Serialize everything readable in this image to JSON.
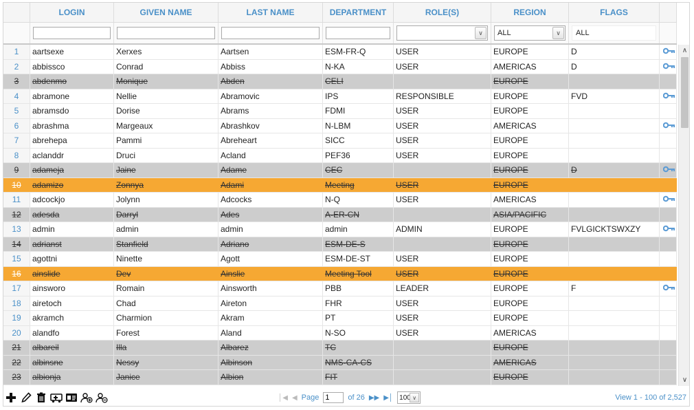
{
  "columns": [
    "LOGIN",
    "GIVEN NAME",
    "LAST NAME",
    "DEPARTMENT",
    "ROLE(S)",
    "REGION",
    "FLAGS"
  ],
  "filters": {
    "login": "",
    "given_name": "",
    "last_name": "",
    "department": "",
    "roles": "",
    "region": "ALL",
    "flags": "ALL"
  },
  "rows": [
    {
      "n": "1",
      "login": "aartsexe",
      "given": "Xerxes",
      "last": "Aartsen",
      "dept": "ESM-FR-Q",
      "role": "USER",
      "region": "EUROPE",
      "flags": "D",
      "state": "normal",
      "key": true
    },
    {
      "n": "2",
      "login": "abbissco",
      "given": "Conrad",
      "last": "Abbiss",
      "dept": "N-KA",
      "role": "USER",
      "region": "AMERICAS",
      "flags": "D",
      "state": "normal",
      "key": true
    },
    {
      "n": "3",
      "login": "abdenmo",
      "given": "Monique",
      "last": "Abden",
      "dept": "CELI",
      "role": "",
      "region": "EUROPE",
      "flags": "",
      "state": "disabled",
      "key": false
    },
    {
      "n": "4",
      "login": "abramone",
      "given": "Nellie",
      "last": "Abramovic",
      "dept": "IPS",
      "role": "RESPONSIBLE",
      "region": "EUROPE",
      "flags": "FVD",
      "state": "normal",
      "key": true
    },
    {
      "n": "5",
      "login": "abramsdo",
      "given": "Dorise",
      "last": "Abrams",
      "dept": "FDMI",
      "role": "USER",
      "region": "EUROPE",
      "flags": "",
      "state": "normal",
      "key": false
    },
    {
      "n": "6",
      "login": "abrashma",
      "given": "Margeaux",
      "last": "Abrashkov",
      "dept": "N-LBM",
      "role": "USER",
      "region": "AMERICAS",
      "flags": "",
      "state": "normal",
      "key": true
    },
    {
      "n": "7",
      "login": "abrehepa",
      "given": "Pammi",
      "last": "Abreheart",
      "dept": "SICC",
      "role": "USER",
      "region": "EUROPE",
      "flags": "",
      "state": "normal",
      "key": false
    },
    {
      "n": "8",
      "login": "aclanddr",
      "given": "Druci",
      "last": "Acland",
      "dept": "PEF36",
      "role": "USER",
      "region": "EUROPE",
      "flags": "",
      "state": "normal",
      "key": false
    },
    {
      "n": "9",
      "login": "adameja",
      "given": "Jaine",
      "last": "Adame",
      "dept": "CEC",
      "role": "",
      "region": "EUROPE",
      "flags": "D",
      "state": "disabled",
      "key": true
    },
    {
      "n": "10",
      "login": "adamizo",
      "given": "Zonnya",
      "last": "Adami",
      "dept": "Meeting",
      "role": "USER",
      "region": "EUROPE",
      "flags": "",
      "state": "orange",
      "key": false
    },
    {
      "n": "11",
      "login": "adcockjo",
      "given": "Jolynn",
      "last": "Adcocks",
      "dept": "N-Q",
      "role": "USER",
      "region": "AMERICAS",
      "flags": "",
      "state": "normal",
      "key": true
    },
    {
      "n": "12",
      "login": "adesda",
      "given": "Darryl",
      "last": "Ades",
      "dept": "A-ER-CN",
      "role": "",
      "region": "ASIA/PACIFIC",
      "flags": "",
      "state": "disabled",
      "key": false
    },
    {
      "n": "13",
      "login": "admin",
      "given": "admin",
      "last": "admin",
      "dept": "admin",
      "role": "ADMIN",
      "region": "EUROPE",
      "flags": "FVLGICKTSWXZY",
      "state": "normal",
      "key": true
    },
    {
      "n": "14",
      "login": "adrianst",
      "given": "Stanfield",
      "last": "Adriano",
      "dept": "ESM-DE-S",
      "role": "",
      "region": "EUROPE",
      "flags": "",
      "state": "disabled",
      "key": false
    },
    {
      "n": "15",
      "login": "agottni",
      "given": "Ninette",
      "last": "Agott",
      "dept": "ESM-DE-ST",
      "role": "USER",
      "region": "EUROPE",
      "flags": "",
      "state": "normal",
      "key": false
    },
    {
      "n": "16",
      "login": "ainslide",
      "given": "Dev",
      "last": "Ainslie",
      "dept": "Meeting Tool",
      "role": "USER",
      "region": "EUROPE",
      "flags": "",
      "state": "orange",
      "key": false
    },
    {
      "n": "17",
      "login": "ainsworo",
      "given": "Romain",
      "last": "Ainsworth",
      "dept": "PBB",
      "role": "LEADER",
      "region": "EUROPE",
      "flags": "F",
      "state": "normal",
      "key": true
    },
    {
      "n": "18",
      "login": "airetoch",
      "given": "Chad",
      "last": "Aireton",
      "dept": "FHR",
      "role": "USER",
      "region": "EUROPE",
      "flags": "",
      "state": "normal",
      "key": false
    },
    {
      "n": "19",
      "login": "akramch",
      "given": "Charmion",
      "last": "Akram",
      "dept": "PT",
      "role": "USER",
      "region": "EUROPE",
      "flags": "",
      "state": "normal",
      "key": false
    },
    {
      "n": "20",
      "login": "alandfo",
      "given": "Forest",
      "last": "Aland",
      "dept": "N-SO",
      "role": "USER",
      "region": "AMERICAS",
      "flags": "",
      "state": "normal",
      "key": false
    },
    {
      "n": "21",
      "login": "albareil",
      "given": "Illa",
      "last": "Albarez",
      "dept": "TC",
      "role": "",
      "region": "EUROPE",
      "flags": "",
      "state": "disabled",
      "key": false
    },
    {
      "n": "22",
      "login": "albinsne",
      "given": "Nessy",
      "last": "Albinson",
      "dept": "NMS-CA-CS",
      "role": "",
      "region": "AMERICAS",
      "flags": "",
      "state": "disabled",
      "key": false
    },
    {
      "n": "23",
      "login": "albionja",
      "given": "Janice",
      "last": "Albion",
      "dept": "FIT",
      "role": "",
      "region": "EUROPE",
      "flags": "",
      "state": "disabled",
      "key": false
    }
  ],
  "pager": {
    "page_label": "Page",
    "page_value": "1",
    "of_label": "of 26",
    "page_size": "100",
    "view_text": "View 1 - 100 of 2,527"
  },
  "icons": [
    "add-icon",
    "edit-icon",
    "delete-icon",
    "ambulance-icon",
    "id-card-icon",
    "add-user-icon",
    "remove-user-icon",
    "key-icon"
  ],
  "colors": {
    "accent": "#4a90c8",
    "disabled_row": "#cdcdcd",
    "highlight_row": "#f6a833"
  }
}
